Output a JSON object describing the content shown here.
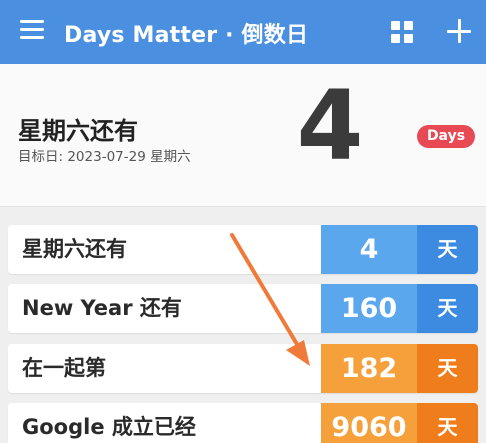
{
  "appbar": {
    "title": "Days Matter · 倒数日",
    "icons": [
      "menu-icon",
      "grid-icon",
      "plus-icon"
    ],
    "color": "#4a8fe0"
  },
  "hero": {
    "title": "星期六还有",
    "target_date": "目标日: 2023-07-29 星期六",
    "count": "4",
    "badge": "Days",
    "badge_color": "#e84a55"
  },
  "events": [
    {
      "label": "星期六还有",
      "count": "4",
      "unit": "天",
      "theme": "blue"
    },
    {
      "label": "New Year 还有",
      "count": "160",
      "unit": "天",
      "theme": "blue"
    },
    {
      "label": "在一起第",
      "count": "182",
      "unit": "天",
      "theme": "orange"
    },
    {
      "label": "Google 成立已经",
      "count": "9060",
      "unit": "天",
      "theme": "orange"
    }
  ],
  "colors": {
    "blue_num": "#5aa7ee",
    "blue_unit": "#3d8be0",
    "orange_num": "#f5a03b",
    "orange_unit": "#f07d1c",
    "annotation_arrow": "#f07a3a"
  }
}
